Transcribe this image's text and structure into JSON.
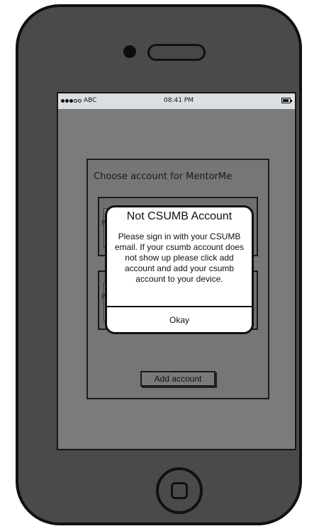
{
  "status_bar": {
    "carrier": "ABC",
    "time": "08:41 PM"
  },
  "account_chooser": {
    "title": "Choose account for MentorMe",
    "account_placeholder_letter": "P",
    "add_account_label": "Add account"
  },
  "alert": {
    "title": "Not CSUMB Account",
    "message": "Please sign in with your CSUMB email. If your csumb account does not show up please click add account and add your csumb account to your device.",
    "ok_label": "Okay"
  },
  "icons": [
    "signal-dots-icon",
    "battery-icon",
    "camera-icon",
    "speaker-icon",
    "home-button-icon"
  ],
  "colors": {
    "phone_body": "#4a4a4a",
    "screen_overlay": "#7b7b7b",
    "status_bar": "#dcdfe2",
    "alert_bg": "#ffffff"
  }
}
